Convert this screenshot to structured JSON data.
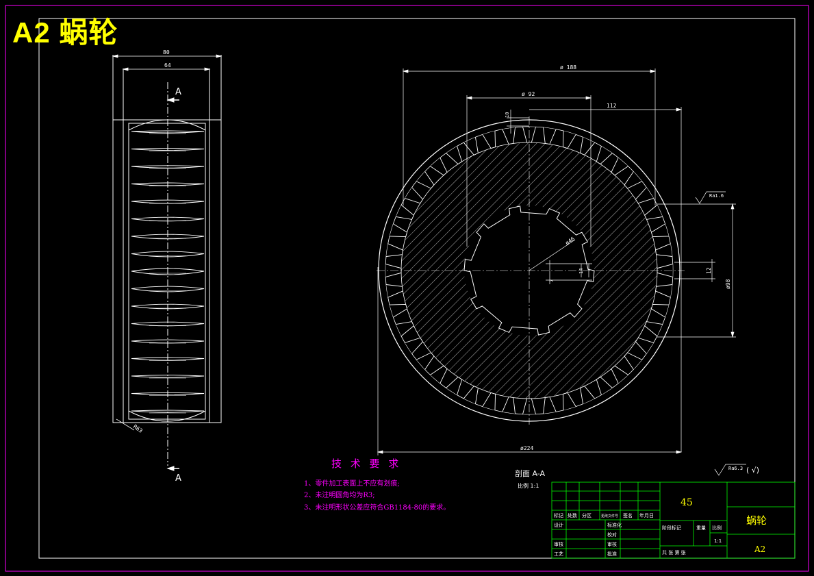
{
  "header": {
    "title": "A2  蜗轮"
  },
  "side_view": {
    "dim_80": "80",
    "dim_64": "64",
    "dim_r63": "R63",
    "section_mark_top": "A",
    "section_mark_bottom": "A"
  },
  "front_view": {
    "dim_188": "ø 188",
    "dim_92": "ø 92",
    "dim_112": "112",
    "dim_10": "10",
    "dim_46": "ø46",
    "dim_14": "14",
    "dim_7": "7",
    "dim_12": "12",
    "dim_98": "ø98",
    "dim_224": "ø224",
    "roughness_local": "Ra1.6",
    "roughness_general": "Ra6.3",
    "roughness_general_suffix": "( √)",
    "section_label": "剖面  A-A",
    "scale_label": "比例  1:1"
  },
  "requirements": {
    "title": "技 术 要 求",
    "items": [
      "1、零件加工表面上不应有划痕;",
      "2、未注明圆角均为R3;",
      "3、未注明形状公差应符合GB1184-80的要求。"
    ]
  },
  "title_block": {
    "material": "45",
    "part_name": "蜗轮",
    "sheet_size": "A2",
    "scale": "1:1",
    "row_labels": [
      "标记",
      "处数",
      "分区",
      "更改文件号",
      "签名",
      "年月日"
    ],
    "designer": "设计",
    "standard": "标准化",
    "review": "审核",
    "process": "工艺",
    "approve": "批准",
    "check": "校对",
    "stage_label": "阶段标记",
    "weight_label": "重量",
    "ratio_label": "比例",
    "sheets_label": "共  张  第  张"
  },
  "colors": {
    "background": "#000000",
    "frame": "#ff00ff",
    "lines": "#ffffff",
    "dims": "#ffffff",
    "title": "#ffff00",
    "table": "#00ff00",
    "req_text": "#ff00ff"
  }
}
